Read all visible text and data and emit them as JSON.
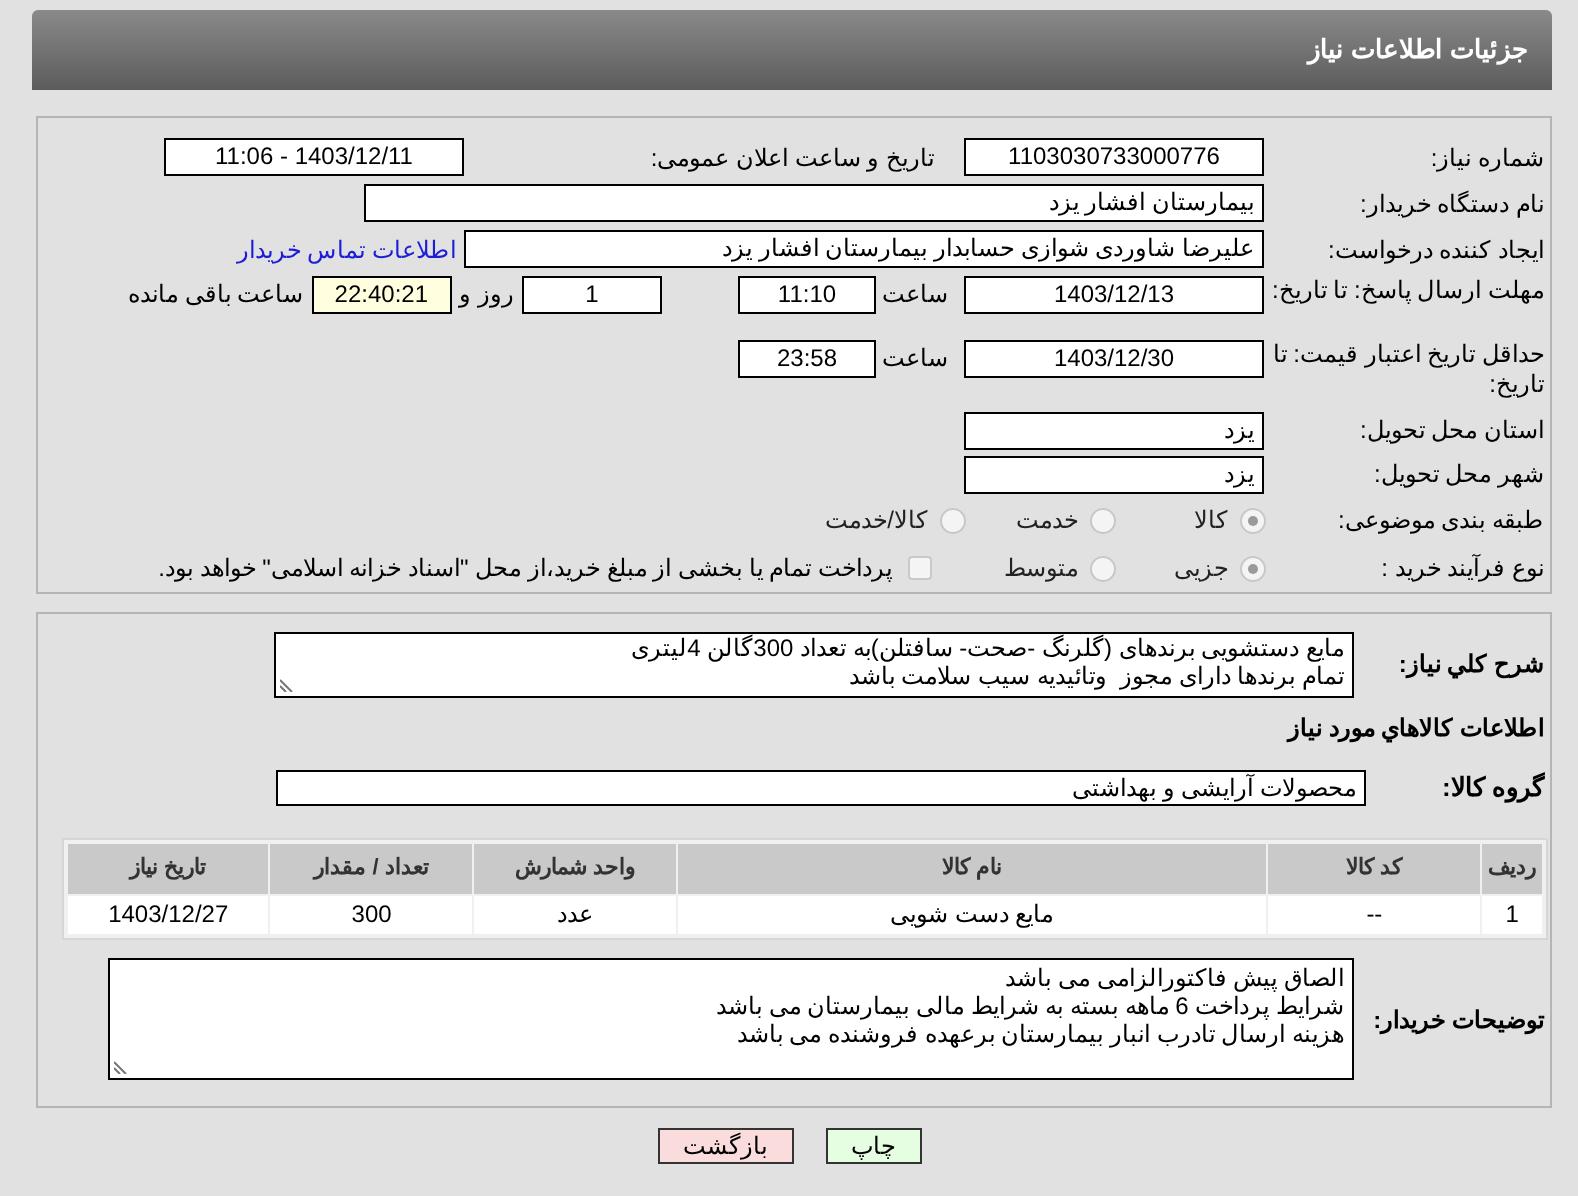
{
  "header": {
    "title": "جزئیات اطلاعات نیاز"
  },
  "need_number": {
    "label": "شماره نیاز:",
    "value": "1103030733000776"
  },
  "announce_datetime": {
    "label": "تاریخ و ساعت اعلان عمومی:",
    "value": "1403/12/11 - 11:06"
  },
  "buyer_org": {
    "label": "نام دستگاه خریدار:",
    "value": "بیمارستان افشار یزد"
  },
  "requester": {
    "label": "ایجاد کننده درخواست:",
    "value": "علیرضا شاوردی شوازی حسابدار بیمارستان افشار یزد",
    "contact_link": "اطلاعات تماس خریدار"
  },
  "response_deadline": {
    "label": "مهلت ارسال پاسخ: تا تاریخ:",
    "date": "1403/12/13",
    "time_label": "ساعت",
    "time": "11:10",
    "days": "1",
    "days_label": "روز و",
    "remaining": "22:40:21",
    "remaining_label": "ساعت باقی مانده"
  },
  "price_validity": {
    "label": "حداقل تاریخ اعتبار قیمت: تا تاریخ:",
    "date": "1403/12/30",
    "time_label": "ساعت",
    "time": "23:58"
  },
  "delivery_province": {
    "label": "استان محل تحویل:",
    "value": "یزد"
  },
  "delivery_city": {
    "label": "شهر محل تحویل:",
    "value": "یزد"
  },
  "category": {
    "label": "طبقه بندی موضوعی:",
    "options": [
      {
        "label": "کالا",
        "selected": true
      },
      {
        "label": "خدمت",
        "selected": false
      },
      {
        "label": "کالا/خدمت",
        "selected": false
      }
    ]
  },
  "purchase_type": {
    "label": "نوع فرآیند خرید :",
    "options": [
      {
        "label": "جزیی",
        "selected": true
      },
      {
        "label": "متوسط",
        "selected": false
      }
    ],
    "treasury_payment": {
      "label": "پرداخت تمام یا بخشی از مبلغ خرید،از محل \"اسناد خزانه اسلامی\" خواهد بود.",
      "checked": false
    }
  },
  "description": {
    "label": "شرح كلي نياز:",
    "lines": [
      "مایع دستشویی برندهای (گلرنگ -صحت- سافتلن)به تعداد 300گالن 4لیتری",
      "تمام برندها دارای مجوز  وتائیدیه سیب سلامت باشد"
    ]
  },
  "goods_heading": "اطلاعات كالاهاي مورد نياز",
  "goods_group": {
    "label": "گروه کالا:",
    "value": "محصولات آرایشی و بهداشتی"
  },
  "table": {
    "columns": [
      "ردیف",
      "کد کالا",
      "نام کالا",
      "واحد شمارش",
      "تعداد / مقدار",
      "تاریخ نیاز"
    ],
    "rows": [
      [
        "1",
        "--",
        "مایع دست شویی",
        "عدد",
        "300",
        "1403/12/27"
      ]
    ]
  },
  "buyer_notes": {
    "label": "توضیحات خریدار:",
    "lines": [
      "الصاق پیش فاکتورالزامی می باشد",
      "شرایط پرداخت 6 ماهه بسته به شرایط مالی بیمارستان می باشد",
      "هزینه ارسال تادرب انبار بیمارستان برعهده فروشنده می باشد"
    ]
  },
  "buttons": [
    {
      "label": "چاپ",
      "kind": "print"
    },
    {
      "label": "بازگشت",
      "kind": "back"
    }
  ]
}
